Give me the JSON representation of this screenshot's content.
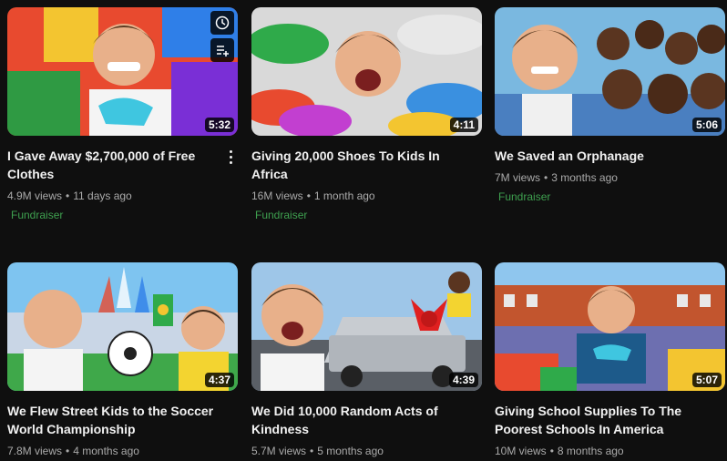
{
  "videos": [
    {
      "title": "I Gave Away $2,700,000 of Free Clothes",
      "views": "4.9M views",
      "age": "11 days ago",
      "badge": "Fundraiser",
      "duration": "5:32",
      "thumb_icon": "person-with-clothes-pile"
    },
    {
      "title": "Giving 20,000 Shoes To Kids In Africa",
      "views": "16M views",
      "age": "1 month ago",
      "badge": "Fundraiser",
      "duration": "4:11",
      "thumb_icon": "person-with-shoes-pile"
    },
    {
      "title": "We Saved an Orphanage",
      "views": "7M views",
      "age": "3 months ago",
      "badge": "Fundraiser",
      "duration": "5:06",
      "thumb_icon": "person-with-children"
    },
    {
      "title": "We Flew Street Kids to the Soccer World Championship",
      "views": "7.8M views",
      "age": "4 months ago",
      "badge": "",
      "duration": "4:37",
      "thumb_icon": "soccer-stadium"
    },
    {
      "title": "We Did 10,000 Random Acts of Kindness",
      "views": "5.7M views",
      "age": "5 months ago",
      "badge": "",
      "duration": "4:39",
      "thumb_icon": "truck-with-bow"
    },
    {
      "title": "Giving School Supplies To The Poorest Schools In America",
      "views": "10M views",
      "age": "8 months ago",
      "badge": "",
      "duration": "5:07",
      "thumb_icon": "school-supplies"
    }
  ],
  "hover_icons": [
    "clock-icon",
    "add-to-queue-icon"
  ],
  "colors": {
    "background": "#0f0f0f",
    "title": "#f1f1f1",
    "meta": "#aaaaaa",
    "fundraiser": "#3ea04f"
  }
}
